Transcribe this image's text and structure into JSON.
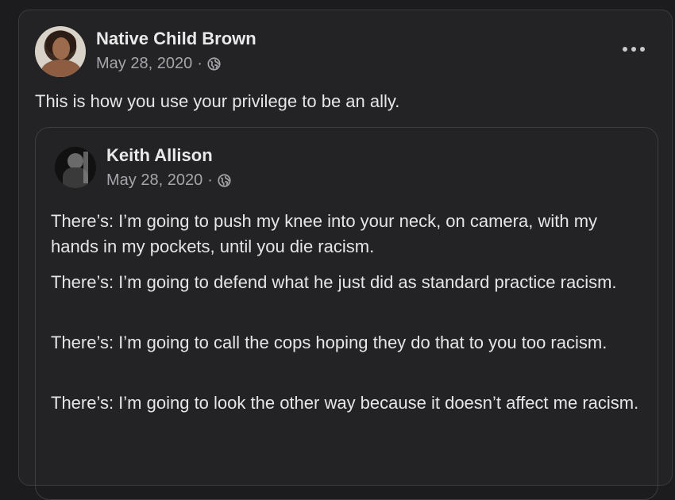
{
  "post": {
    "author": "Native Child Brown",
    "date": "May 28, 2020",
    "separator": "·",
    "audience_icon": "globe-icon",
    "more_icon": "more-options-icon",
    "text": "This is how you use your privilege to be an ally."
  },
  "shared_post": {
    "author": "Keith Allison",
    "date": "May 28, 2020",
    "separator": "·",
    "audience_icon": "globe-icon",
    "paragraphs": [
      "There’s: I’m going to push my knee into your neck, on camera, with my hands in my pockets, until you die racism.",
      "There’s: I’m going to defend what he just did as standard practice racism.",
      "There’s: I’m going to call the cops hoping they do that to you too racism.",
      "There’s: I’m going to look the other way because it doesn’t affect me racism."
    ]
  },
  "colors": {
    "page_background": "#1c1c1e",
    "card_background": "#232325",
    "border": "#3a3a3d",
    "primary_text": "#e9e9ea",
    "secondary_text": "#a6a6aa"
  }
}
